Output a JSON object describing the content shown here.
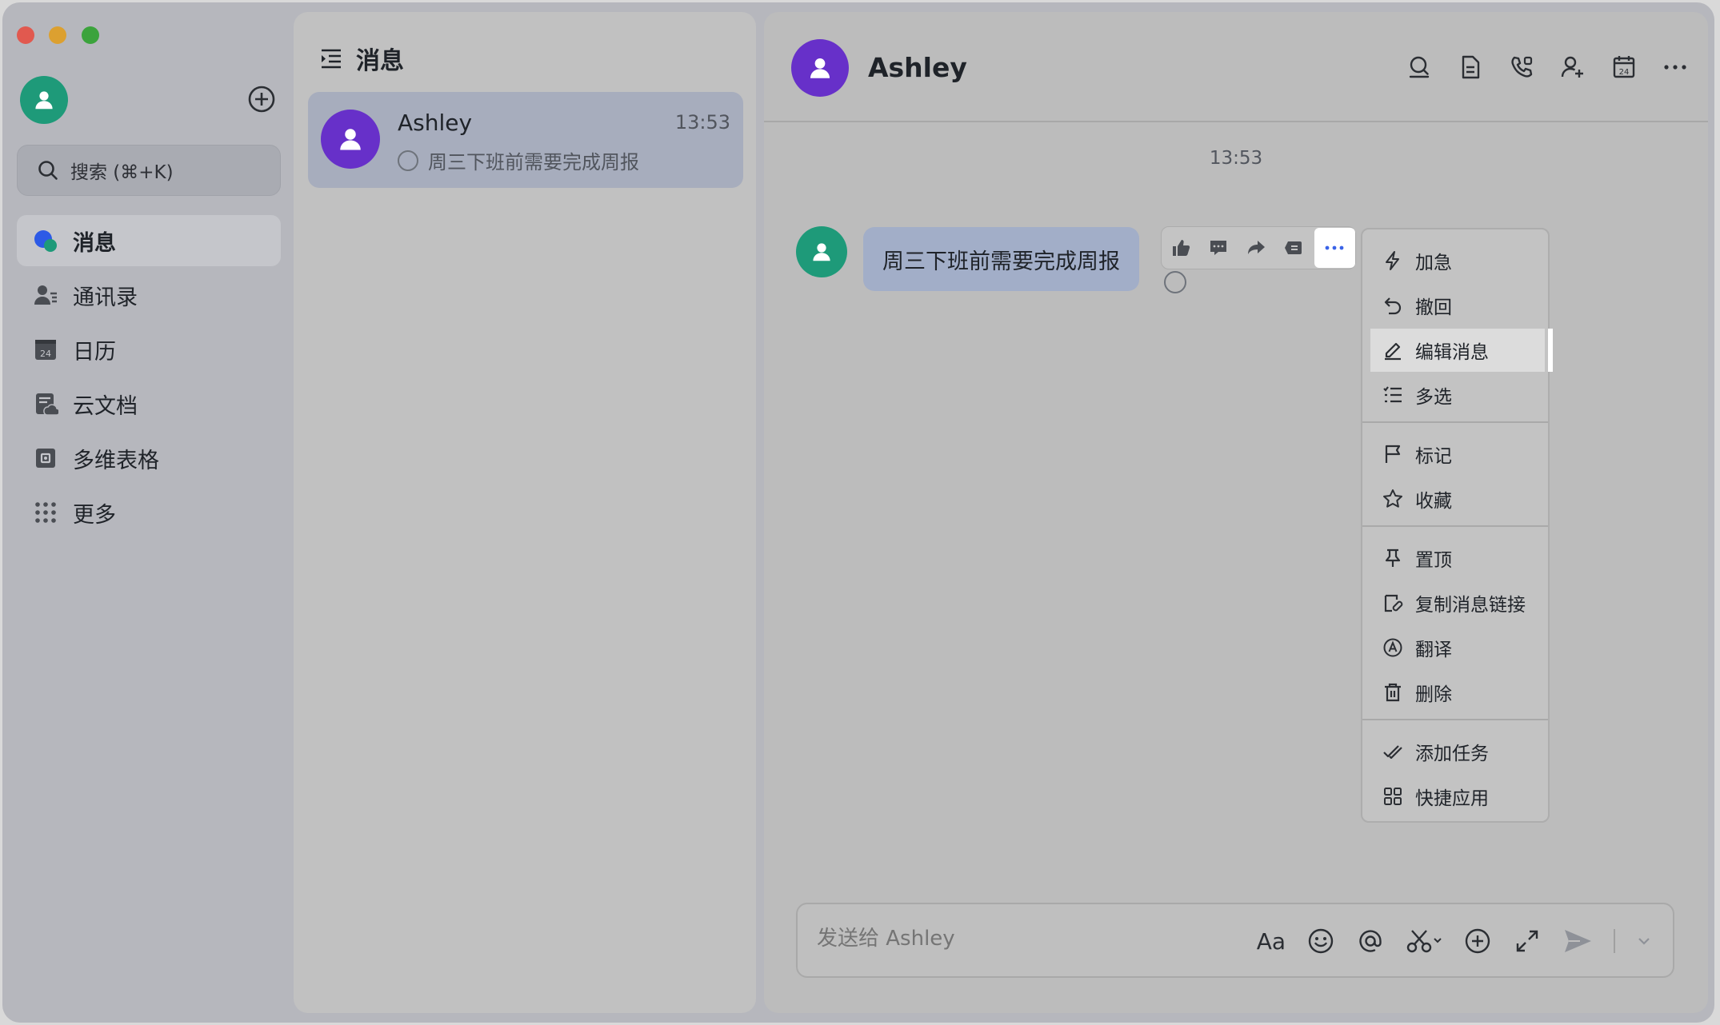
{
  "sidebar": {
    "search_placeholder": "搜索 (⌘+K)",
    "nav": [
      {
        "label": "消息",
        "icon": "chat-bubble-icon",
        "active": true
      },
      {
        "label": "通讯录",
        "icon": "contacts-icon"
      },
      {
        "label": "日历",
        "icon": "calendar-icon"
      },
      {
        "label": "云文档",
        "icon": "cloud-doc-icon"
      },
      {
        "label": "多维表格",
        "icon": "base-table-icon"
      },
      {
        "label": "更多",
        "icon": "grid-dots-icon"
      }
    ]
  },
  "chatlist": {
    "title": "消息",
    "items": [
      {
        "name": "Ashley",
        "time": "13:53",
        "preview": "周三下班前需要完成周报"
      }
    ]
  },
  "conversation": {
    "title": "Ashley",
    "timestamp": "13:53",
    "message": "周三下班前需要完成周报",
    "composer_placeholder": "发送给 Ashley",
    "font_button_label": "Aa"
  },
  "context_menu": {
    "items": [
      {
        "label": "加急",
        "icon": "lightning-icon"
      },
      {
        "label": "撤回",
        "icon": "undo-icon"
      },
      {
        "label": "编辑消息",
        "icon": "edit-icon",
        "highlighted": true
      },
      {
        "label": "多选",
        "icon": "multi-select-icon"
      },
      {
        "label": "标记",
        "icon": "flag-icon"
      },
      {
        "label": "收藏",
        "icon": "star-icon"
      },
      {
        "label": "置顶",
        "icon": "pin-icon"
      },
      {
        "label": "复制消息链接",
        "icon": "copy-link-icon"
      },
      {
        "label": "翻译",
        "icon": "translate-icon"
      },
      {
        "label": "删除",
        "icon": "trash-icon"
      },
      {
        "label": "添加任务",
        "icon": "add-task-icon"
      },
      {
        "label": "快捷应用",
        "icon": "apps-icon"
      }
    ]
  },
  "colors": {
    "accent_purple": "#6730c9",
    "accent_green": "#1e9a79",
    "more_dots_blue": "#3a63e8"
  }
}
